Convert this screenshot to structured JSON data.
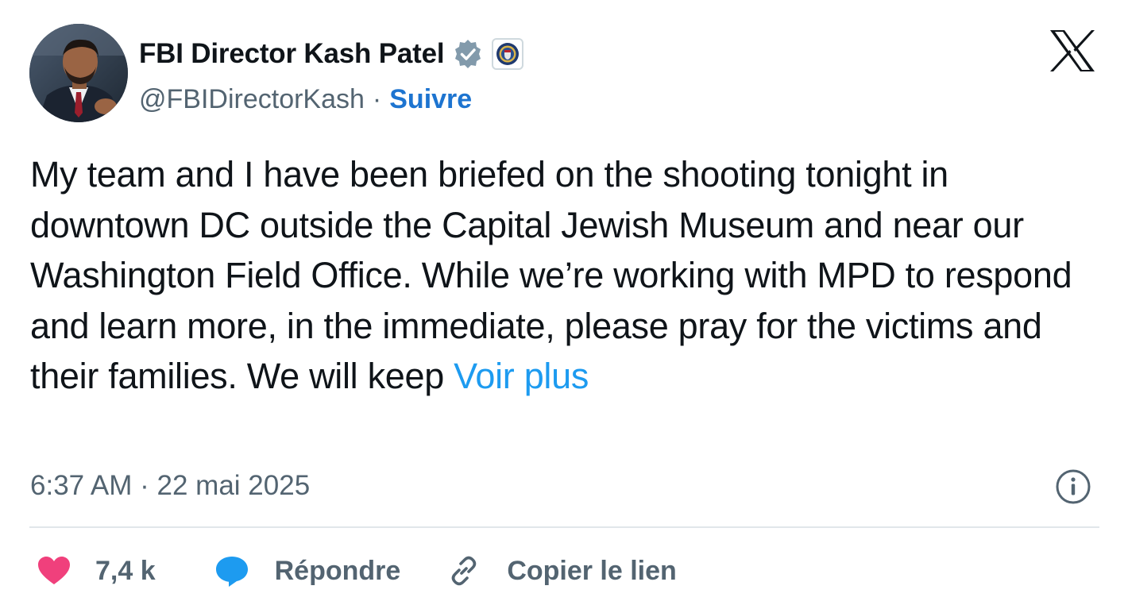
{
  "author": {
    "name": "FBI Director Kash Patel",
    "handle": "@FBIDirectorKash",
    "follow_label": "Suivre",
    "separator": "·"
  },
  "tweet": {
    "text": "My team and I have been briefed on the shooting tonight in downtown DC outside the Capital Jewish Museum and near our Washington Field Office. While we’re working with MPD to respond and learn more, in the immediate, please pray for the victims and their families. We will keep ",
    "more_label": "Voir plus",
    "time": "6:37 AM",
    "date": "22 mai 2025",
    "meta_separator": " · "
  },
  "actions": {
    "likes": "7,4 k",
    "reply_label": "Répondre",
    "copy_label": "Copier le lien"
  },
  "icons": {
    "verified": "verified-badge-icon",
    "affiliate": "fbi-seal-icon",
    "brand": "x-logo-icon",
    "info": "info-icon",
    "like": "heart-icon",
    "reply": "speech-bubble-icon",
    "copy": "link-icon"
  },
  "colors": {
    "text": "#0f1419",
    "secondary": "#536471",
    "link": "#1d9bf0",
    "follow": "#1d74d0",
    "heart": "#f0407c",
    "bubble": "#1d9bf0",
    "verified": "#829aab"
  }
}
